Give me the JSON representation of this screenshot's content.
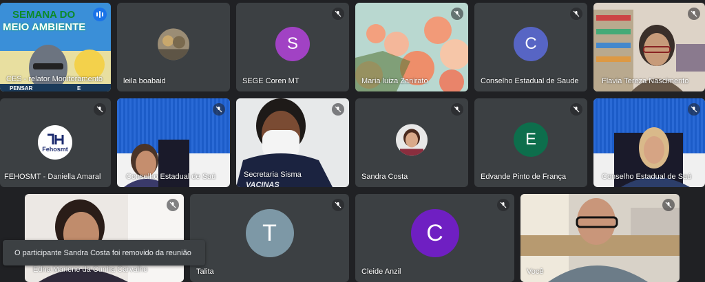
{
  "participants": [
    {
      "name": "CES - relator Monitoramento",
      "banner_title_1": "SEMANA DO",
      "banner_title_2": "MEIO AMBIENTE",
      "banner_bottom": "PENSAR",
      "banner_bottom_2": "E"
    },
    {
      "name": "leila boabaid"
    },
    {
      "name": "SEGE Coren MT",
      "initial": "S",
      "color": "#a142c4"
    },
    {
      "name": "Maria luiza Zanirato"
    },
    {
      "name": "Conselho Estadual de Saude",
      "initial": "C",
      "color": "#5765c4"
    },
    {
      "name": "Flavia Tereza Nascimento"
    },
    {
      "name": "FEHOSMT - Daniella Amaral",
      "logo_text": "Fehosmt"
    },
    {
      "name": "Conselho Estadual de Saú"
    },
    {
      "name": "Secretaria Sisma",
      "shirt_text": "VACINAS"
    },
    {
      "name": "Sandra Costa"
    },
    {
      "name": "Edvande Pinto de França",
      "initial": "E",
      "color": "#0d6e4c"
    },
    {
      "name": "Conselho Estadual de Saú"
    },
    {
      "name": "Edna Marlene da Cunha Carvalho"
    },
    {
      "name": "Talita",
      "initial": "T",
      "color": "#7d98a6"
    },
    {
      "name": "Cleide Anzil",
      "initial": "C",
      "color": "#6f1fc2"
    },
    {
      "name": "Você"
    }
  ],
  "notification": "O participante Sandra Costa foi removido da reunião",
  "colors": {
    "background": "#202124",
    "tile": "#3c4043"
  },
  "icons": {
    "muted": "mic-off-icon",
    "speaking": "audio-level-icon"
  }
}
